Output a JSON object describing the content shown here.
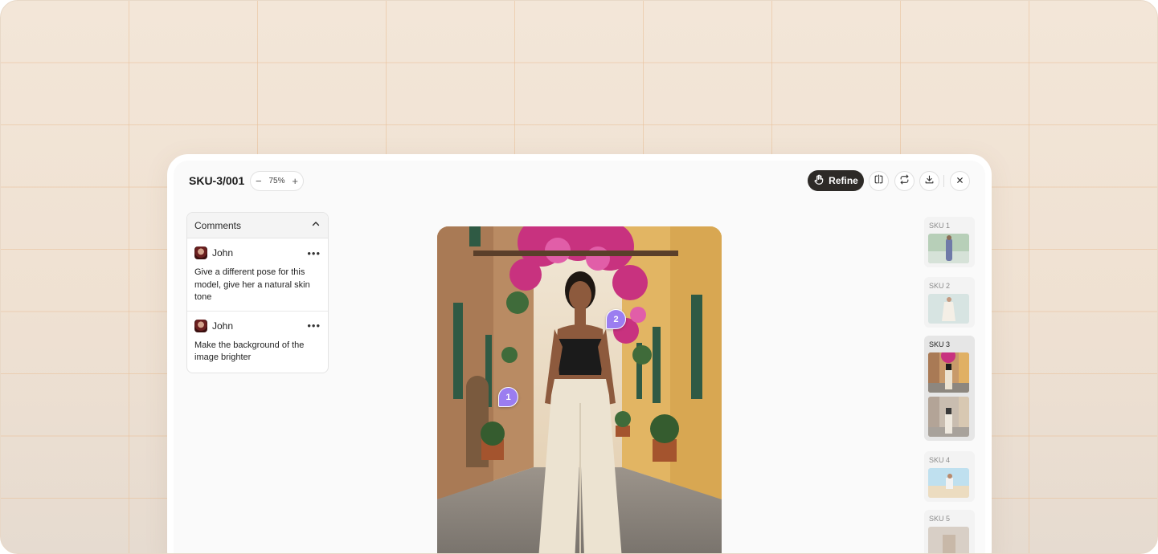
{
  "viewer": {
    "sku_title": "SKU-3/001",
    "zoom": {
      "minus": "−",
      "level": "75%",
      "plus": "+"
    },
    "refine_label": "Refine"
  },
  "comments": {
    "header": "Comments",
    "items": [
      {
        "author": "John",
        "text": "Give a different pose for this model, give her a natural skin tone"
      },
      {
        "author": "John",
        "text": "Make the background of the image brighter"
      }
    ]
  },
  "pins": [
    "1",
    "2"
  ],
  "sku_list": [
    {
      "label": "SKU 1",
      "thumbs": 1,
      "active": false
    },
    {
      "label": "SKU 2",
      "thumbs": 1,
      "active": false
    },
    {
      "label": "SKU 3",
      "thumbs": 2,
      "active": true
    },
    {
      "label": "SKU 4",
      "thumbs": 1,
      "active": false
    },
    {
      "label": "SKU 5",
      "thumbs": 1,
      "active": false
    }
  ],
  "colors": {
    "accent_pin": "#9b7df0",
    "refine_button": "#2d2a27"
  },
  "icons": [
    "zoom-out-icon",
    "zoom-in-icon",
    "hand-icon",
    "compare-icon",
    "swap-icon",
    "download-icon",
    "close-icon",
    "chevron-up-icon",
    "more-icon"
  ]
}
